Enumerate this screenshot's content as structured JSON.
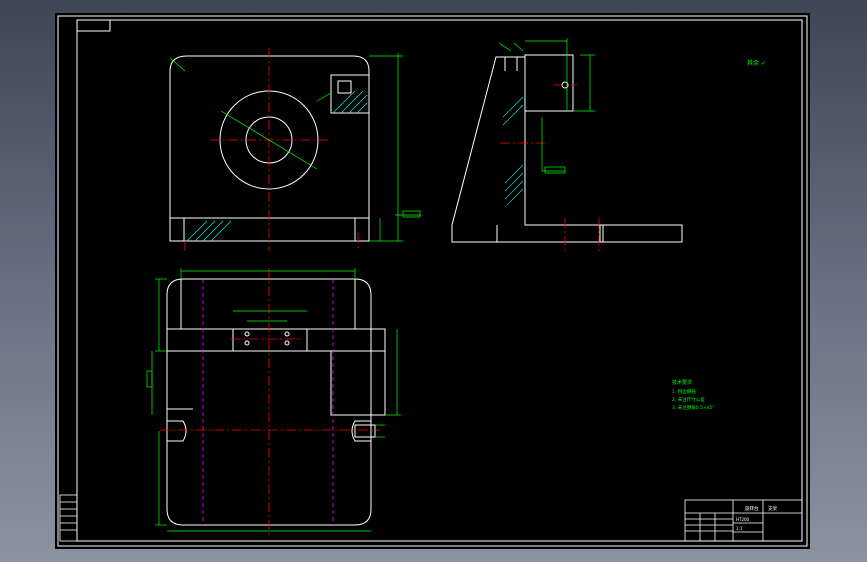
{
  "colors": {
    "background": "#000000",
    "outline": "#ffffff",
    "dimension": "#00ff00",
    "centerline": "#ff0000",
    "hidden": "#ff00ff",
    "hatch": "#00ffff"
  },
  "annotations": {
    "top_right_note": "其余 ✓",
    "tech_req_title": "技术要求",
    "tech_req_1": "1. 锐边倒钝",
    "tech_req_2": "2. 未注尺寸公差",
    "tech_req_3": "3. 未注倒角0.5×45°"
  },
  "title_block": {
    "part_name": "旋转台",
    "drawing_no": "支架",
    "material": "HT200",
    "scale": "1:1"
  }
}
